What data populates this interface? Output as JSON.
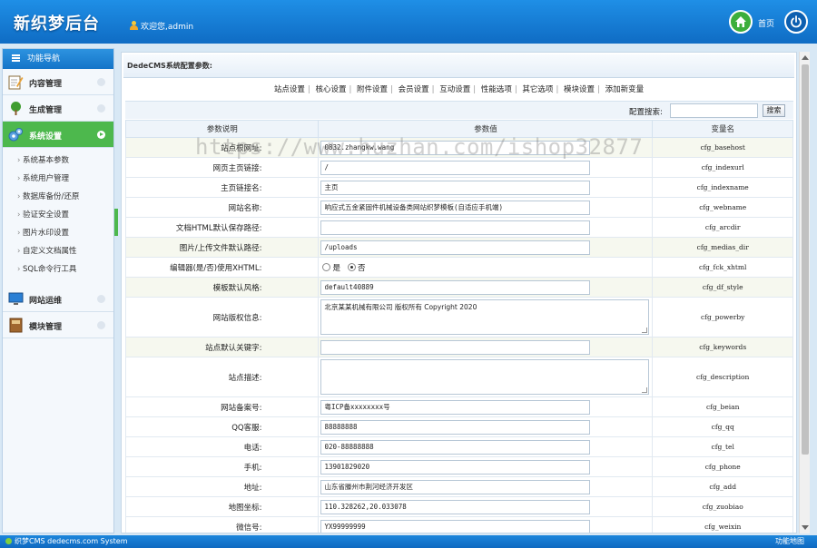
{
  "header": {
    "logo": "新织梦后台",
    "welcome": "欢迎您,admin",
    "home_label": "首页"
  },
  "sidebar": {
    "title": "功能导航",
    "menus": [
      {
        "label": "内容管理",
        "icon": "pencil-note-icon"
      },
      {
        "label": "生成管理",
        "icon": "tree-icon"
      },
      {
        "label": "系统设置",
        "icon": "gears-icon"
      },
      {
        "label": "网站运维",
        "icon": "monitor-icon"
      },
      {
        "label": "模块管理",
        "icon": "book-icon"
      }
    ],
    "sub_items": [
      "系统基本参数",
      "系统用户管理",
      "数据库备份/还原",
      "验证安全设置",
      "图片水印设置",
      "自定义文档属性",
      "SQL命令行工具"
    ]
  },
  "content": {
    "title": "DedeCMS系统配置参数:",
    "tabs": [
      "站点设置",
      "核心设置",
      "附件设置",
      "会员设置",
      "互动设置",
      "性能选项",
      "其它选项",
      "模块设置",
      "添加新变量"
    ],
    "search_label": "配置搜索:",
    "search_button": "搜索",
    "columns": [
      "参数说明",
      "参数值",
      "变量名"
    ],
    "rows": [
      {
        "label": "站点根网址:",
        "value": "0832.zhangkw.wang",
        "var": "cfg_basehost",
        "type": "input"
      },
      {
        "label": "网页主页链接:",
        "value": "/",
        "var": "cfg_indexurl",
        "type": "input"
      },
      {
        "label": "主页链接名:",
        "value": "主页",
        "var": "cfg_indexname",
        "type": "input"
      },
      {
        "label": "网站名称:",
        "value": "响应式五金紧固件机械设备类网站织梦模板(自适应手机端)",
        "var": "cfg_webname",
        "type": "input"
      },
      {
        "label": "文档HTML默认保存路径:",
        "value": "",
        "var": "cfg_arcdir",
        "type": "input"
      },
      {
        "label": "图片/上传文件默认路径:",
        "value": "/uploads",
        "var": "cfg_medias_dir",
        "type": "input"
      },
      {
        "label": "编辑器(是/否)使用XHTML:",
        "value": "",
        "var": "cfg_fck_xhtml",
        "type": "radio",
        "options": [
          "是",
          "否"
        ],
        "selected": "否"
      },
      {
        "label": "模板默认风格:",
        "value": "default40889",
        "var": "cfg_df_style",
        "type": "input"
      },
      {
        "label": "网站版权信息:",
        "value": "北京某某机械有限公司 版权所有 Copyright 2020",
        "var": "cfg_powerby",
        "type": "textarea"
      },
      {
        "label": "站点默认关键字:",
        "value": "",
        "var": "cfg_keywords",
        "type": "input"
      },
      {
        "label": "站点描述:",
        "value": "",
        "var": "cfg_description",
        "type": "textarea"
      },
      {
        "label": "网站备案号:",
        "value": "粤ICP备xxxxxxxx号",
        "var": "cfg_beian",
        "type": "input"
      },
      {
        "label": "QQ客服:",
        "value": "88888888",
        "var": "cfg_qq",
        "type": "input"
      },
      {
        "label": "电话:",
        "value": "020-88888888",
        "var": "cfg_tel",
        "type": "input"
      },
      {
        "label": "手机:",
        "value": "13901829020",
        "var": "cfg_phone",
        "type": "input"
      },
      {
        "label": "地址:",
        "value": "山东省滕州市荆河经济开发区",
        "var": "cfg_add",
        "type": "input"
      },
      {
        "label": "地图坐标:",
        "value": "110.328262,20.033078",
        "var": "cfg_zuobiao",
        "type": "input"
      },
      {
        "label": "微信号:",
        "value": "YX99999999",
        "var": "cfg_weixin",
        "type": "input"
      }
    ]
  },
  "watermark": "https://www.huzhan.com/ishop32877",
  "footer": {
    "brand": "织梦CMS",
    "system": "dedecms.com System",
    "map": "功能地图"
  },
  "colors": {
    "accent": "#1474c8",
    "active_menu": "#4db84d"
  }
}
